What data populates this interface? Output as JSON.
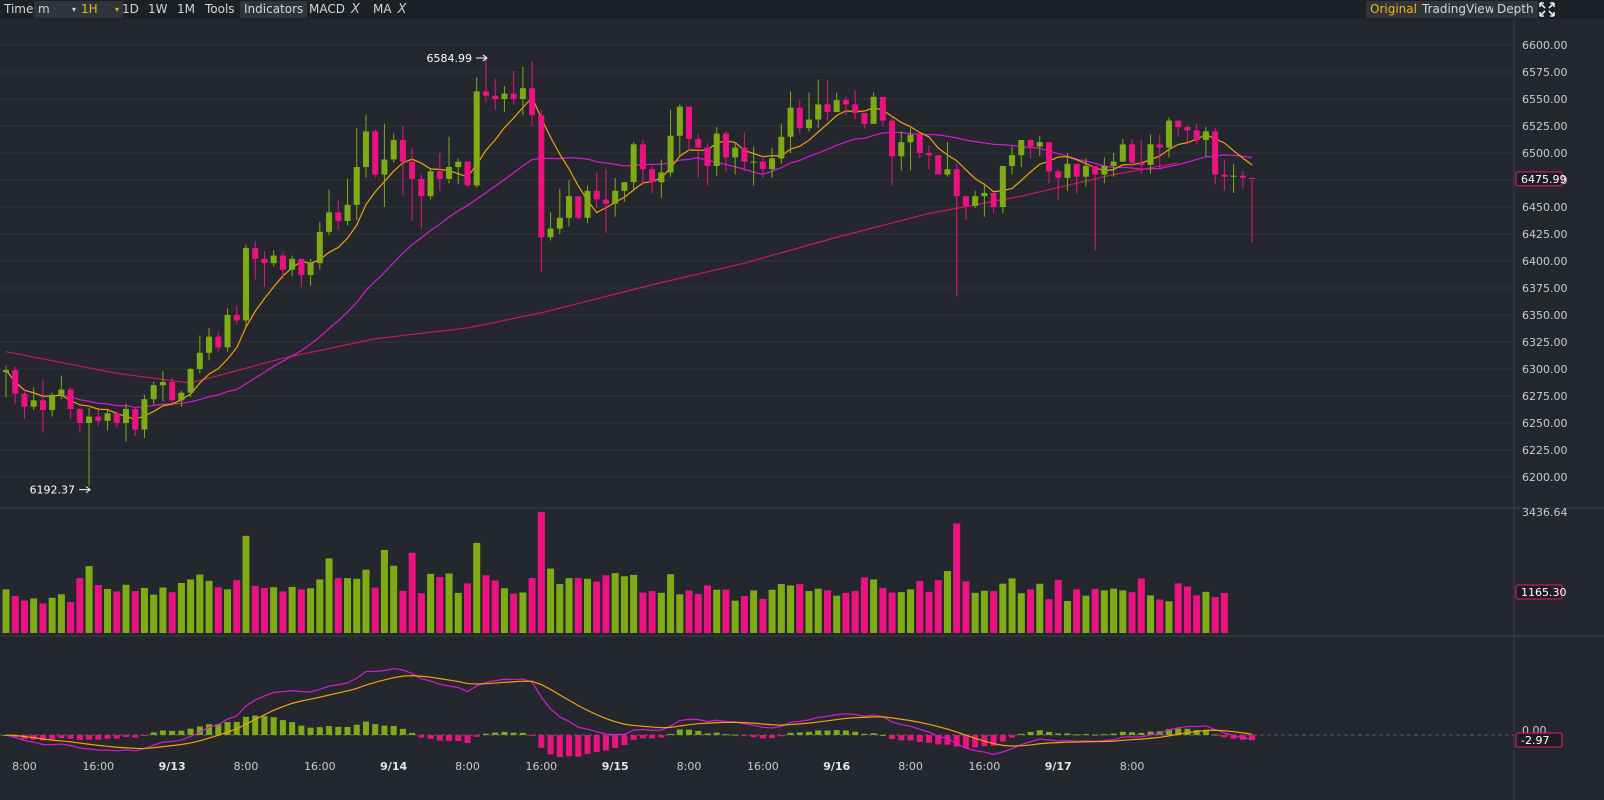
{
  "toolbar": {
    "time": "Time",
    "minute": "m",
    "hour": "1H",
    "day": "1D",
    "week": "1W",
    "month": "1M",
    "tools": "Tools",
    "indicators": "Indicators",
    "macd": "MACD",
    "ma": "MA",
    "close_mark": "X",
    "original": "Original",
    "tradingview": "TradingView",
    "depth": "Depth",
    "fullscreen_icon": "fullscreen-icon"
  },
  "colors": {
    "up": "#7fac15",
    "down": "#ec1380",
    "ma7": "#f0a30a",
    "ma25": "#d61ad6",
    "ma99": "#c9195e",
    "active": "#f0b90b"
  },
  "chart_data": {
    "type": "candlestick",
    "timeframe": "1H",
    "price_axis": {
      "range": [
        6187.5,
        6612.5
      ],
      "ticks": [
        "6200.00",
        "6225.00",
        "6250.00",
        "6275.00",
        "6300.00",
        "6325.00",
        "6350.00",
        "6375.00",
        "6400.00",
        "6425.00",
        "6450.00",
        "6475.00",
        "6500.00",
        "6525.00",
        "6550.00",
        "6575.00",
        "6600.00"
      ]
    },
    "volume_axis": {
      "max": 3436.64,
      "max_label": "3436.64",
      "current_label": "1165.30",
      "current": 1165.3
    },
    "macd_axis": {
      "zero_label": "0.00",
      "current_label": "-2.97",
      "current": -2.97
    },
    "current_price": 6475.99,
    "current_price_label": "6475.99",
    "high_label": "6584.99",
    "low_label": "6192.37",
    "x_labels": [
      {
        "text": "8:00",
        "date": false,
        "i": 2
      },
      {
        "text": "16:00",
        "date": false,
        "i": 10
      },
      {
        "text": "9/13",
        "date": true,
        "i": 18
      },
      {
        "text": "8:00",
        "date": false,
        "i": 26
      },
      {
        "text": "16:00",
        "date": false,
        "i": 34
      },
      {
        "text": "9/14",
        "date": true,
        "i": 42
      },
      {
        "text": "8:00",
        "date": false,
        "i": 50
      },
      {
        "text": "16:00",
        "date": false,
        "i": 58
      },
      {
        "text": "9/15",
        "date": true,
        "i": 66
      },
      {
        "text": "8:00",
        "date": false,
        "i": 74
      },
      {
        "text": "16:00",
        "date": false,
        "i": 82
      },
      {
        "text": "9/16",
        "date": true,
        "i": 90
      },
      {
        "text": "8:00",
        "date": false,
        "i": 98
      },
      {
        "text": "16:00",
        "date": false,
        "i": 106
      },
      {
        "text": "9/17",
        "date": true,
        "i": 114
      },
      {
        "text": "8:00",
        "date": false,
        "i": 122
      }
    ],
    "ma_windows": [
      7,
      25,
      99
    ],
    "ma99_points": [
      [
        0,
        6316
      ],
      [
        12,
        6296
      ],
      [
        20,
        6287
      ],
      [
        30,
        6310
      ],
      [
        40,
        6328
      ],
      [
        50,
        6338
      ],
      [
        58,
        6352
      ],
      [
        70,
        6378
      ],
      [
        80,
        6398
      ],
      [
        90,
        6422
      ],
      [
        100,
        6444
      ],
      [
        110,
        6460
      ],
      [
        120,
        6480
      ],
      [
        127,
        6491
      ]
    ],
    "candles": [
      [
        6297,
        6299,
        6303,
        6274
      ],
      [
        6299,
        6277,
        6302,
        6268
      ],
      [
        6277,
        6265,
        6282,
        6254
      ],
      [
        6265,
        6271,
        6283,
        6262
      ],
      [
        6271,
        6262,
        6290,
        6241
      ],
      [
        6262,
        6276,
        6278,
        6256
      ],
      [
        6276,
        6281,
        6294,
        6272
      ],
      [
        6281,
        6263,
        6283,
        6254
      ],
      [
        6263,
        6250,
        6264,
        6241
      ],
      [
        6250,
        6256,
        6264,
        6192
      ],
      [
        6256,
        6252,
        6262,
        6247
      ],
      [
        6252,
        6259,
        6262,
        6243
      ],
      [
        6259,
        6250,
        6261,
        6246
      ],
      [
        6250,
        6263,
        6268,
        6233
      ],
      [
        6263,
        6244,
        6265,
        6238
      ],
      [
        6244,
        6272,
        6276,
        6236
      ],
      [
        6272,
        6285,
        6288,
        6267
      ],
      [
        6285,
        6288,
        6298,
        6270
      ],
      [
        6288,
        6271,
        6292,
        6268
      ],
      [
        6271,
        6278,
        6280,
        6265
      ],
      [
        6278,
        6300,
        6301,
        6274
      ],
      [
        6300,
        6315,
        6331,
        6296
      ],
      [
        6315,
        6330,
        6338,
        6308
      ],
      [
        6330,
        6320,
        6334,
        6316
      ],
      [
        6320,
        6350,
        6356,
        6316
      ],
      [
        6350,
        6345,
        6359,
        6341
      ],
      [
        6345,
        6412,
        6415,
        6339
      ],
      [
        6412,
        6402,
        6418,
        6383
      ],
      [
        6402,
        6398,
        6409,
        6376
      ],
      [
        6398,
        6405,
        6410,
        6395
      ],
      [
        6405,
        6392,
        6408,
        6383
      ],
      [
        6392,
        6402,
        6405,
        6386
      ],
      [
        6402,
        6387,
        6398,
        6376
      ],
      [
        6387,
        6398,
        6402,
        6377
      ],
      [
        6398,
        6427,
        6436,
        6392
      ],
      [
        6427,
        6445,
        6466,
        6424
      ],
      [
        6445,
        6437,
        6456,
        6429
      ],
      [
        6437,
        6452,
        6476,
        6433
      ],
      [
        6452,
        6487,
        6523,
        6438
      ],
      [
        6487,
        6520,
        6535,
        6477
      ],
      [
        6520,
        6480,
        6522,
        6477
      ],
      [
        6480,
        6494,
        6527,
        6450
      ],
      [
        6494,
        6512,
        6518,
        6491
      ],
      [
        6512,
        6492,
        6525,
        6461
      ],
      [
        6492,
        6476,
        6505,
        6437
      ],
      [
        6476,
        6460,
        6480,
        6430
      ],
      [
        6460,
        6483,
        6486,
        6457
      ],
      [
        6483,
        6476,
        6500,
        6465
      ],
      [
        6476,
        6487,
        6515,
        6472
      ],
      [
        6487,
        6492,
        6495,
        6471
      ],
      [
        6492,
        6470,
        6491,
        6468
      ],
      [
        6470,
        6557,
        6570,
        6468
      ],
      [
        6557,
        6553,
        6588,
        6547
      ],
      [
        6553,
        6550,
        6569,
        6540
      ],
      [
        6550,
        6555,
        6562,
        6538
      ],
      [
        6555,
        6550,
        6576,
        6545
      ],
      [
        6550,
        6560,
        6580,
        6535
      ],
      [
        6560,
        6535,
        6585,
        6525
      ],
      [
        6535,
        6422,
        6540,
        6390
      ],
      [
        6422,
        6430,
        6445,
        6419
      ],
      [
        6430,
        6440,
        6467,
        6425
      ],
      [
        6440,
        6460,
        6475,
        6432
      ],
      [
        6460,
        6440,
        6458,
        6438
      ],
      [
        6440,
        6465,
        6470,
        6435
      ],
      [
        6465,
        6457,
        6482,
        6449
      ],
      [
        6457,
        6453,
        6485,
        6426
      ],
      [
        6453,
        6465,
        6477,
        6441
      ],
      [
        6465,
        6473,
        6473,
        6455
      ],
      [
        6473,
        6508,
        6510,
        6465
      ],
      [
        6508,
        6485,
        6512,
        6470
      ],
      [
        6485,
        6473,
        6488,
        6463
      ],
      [
        6473,
        6482,
        6494,
        6458
      ],
      [
        6482,
        6516,
        6540,
        6478
      ],
      [
        6516,
        6543,
        6545,
        6497
      ],
      [
        6543,
        6513,
        6540,
        6502
      ],
      [
        6513,
        6505,
        6518,
        6477
      ],
      [
        6505,
        6488,
        6509,
        6470
      ],
      [
        6488,
        6518,
        6524,
        6479
      ],
      [
        6518,
        6496,
        6520,
        6483
      ],
      [
        6496,
        6505,
        6510,
        6480
      ],
      [
        6505,
        6492,
        6519,
        6483
      ],
      [
        6492,
        6492,
        6506,
        6470
      ],
      [
        6492,
        6485,
        6498,
        6477
      ],
      [
        6485,
        6495,
        6505,
        6477
      ],
      [
        6495,
        6515,
        6527,
        6490
      ],
      [
        6515,
        6542,
        6557,
        6500
      ],
      [
        6542,
        6523,
        6549,
        6518
      ],
      [
        6523,
        6531,
        6556,
        6520
      ],
      [
        6531,
        6545,
        6568,
        6523
      ],
      [
        6545,
        6538,
        6567,
        6530
      ],
      [
        6538,
        6549,
        6556,
        6540
      ],
      [
        6549,
        6545,
        6552,
        6535
      ],
      [
        6545,
        6537,
        6558,
        6531
      ],
      [
        6537,
        6527,
        6534,
        6523
      ],
      [
        6527,
        6552,
        6556,
        6528
      ],
      [
        6552,
        6530,
        6542,
        6525
      ],
      [
        6530,
        6497,
        6532,
        6470
      ],
      [
        6497,
        6510,
        6520,
        6484
      ],
      [
        6510,
        6517,
        6523,
        6484
      ],
      [
        6517,
        6500,
        6518,
        6495
      ],
      [
        6500,
        6498,
        6507,
        6485
      ],
      [
        6498,
        6480,
        6493,
        6482
      ],
      [
        6480,
        6485,
        6510,
        6478
      ],
      [
        6485,
        6460,
        6490,
        6367
      ],
      [
        6460,
        6451,
        6458,
        6438
      ],
      [
        6451,
        6460,
        6465,
        6449
      ],
      [
        6460,
        6463,
        6472,
        6441
      ],
      [
        6463,
        6450,
        6453,
        6444
      ],
      [
        6450,
        6488,
        6488,
        6444
      ],
      [
        6488,
        6498,
        6506,
        6480
      ],
      [
        6498,
        6512,
        6512,
        6487
      ],
      [
        6512,
        6506,
        6513,
        6495
      ],
      [
        6506,
        6510,
        6516,
        6497
      ],
      [
        6510,
        6483,
        6508,
        6472
      ],
      [
        6483,
        6477,
        6485,
        6457
      ],
      [
        6477,
        6490,
        6500,
        6465
      ],
      [
        6490,
        6478,
        6485,
        6462
      ],
      [
        6478,
        6488,
        6495,
        6469
      ],
      [
        6488,
        6480,
        6485,
        6410
      ],
      [
        6480,
        6488,
        6496,
        6472
      ],
      [
        6488,
        6492,
        6500,
        6478
      ],
      [
        6492,
        6508,
        6513,
        6493
      ],
      [
        6508,
        6491,
        6513,
        6488
      ],
      [
        6491,
        6489,
        6512,
        6481
      ],
      [
        6489,
        6508,
        6517,
        6481
      ],
      [
        6508,
        6505,
        6518,
        6485
      ],
      [
        6505,
        6530,
        6533,
        6496
      ],
      [
        6530,
        6524,
        6528,
        6516
      ],
      [
        6524,
        6521,
        6526,
        6508
      ],
      [
        6521,
        6512,
        6527,
        6508
      ],
      [
        6512,
        6520,
        6524,
        6497
      ],
      [
        6520,
        6480,
        6523,
        6471
      ],
      [
        6480,
        6478,
        6494,
        6465
      ],
      [
        6478,
        6479,
        6490,
        6463
      ],
      [
        6479,
        6477,
        6483,
        6467
      ],
      [
        6477,
        6476,
        6475,
        6417
      ]
    ],
    "volumes": [
      1240,
      1050,
      920,
      980,
      840,
      1000,
      1100,
      880,
      1560,
      1900,
      1360,
      1250,
      1180,
      1370,
      1190,
      1280,
      1090,
      1290,
      1160,
      1420,
      1520,
      1660,
      1480,
      1300,
      1240,
      1500,
      2760,
      1340,
      1280,
      1300,
      1180,
      1310,
      1240,
      1270,
      1520,
      2120,
      1560,
      1560,
      1540,
      1800,
      1290,
      2360,
      1910,
      1200,
      2280,
      1130,
      1680,
      1590,
      1690,
      1140,
      1410,
      2560,
      1640,
      1490,
      1270,
      1120,
      1150,
      1560,
      3440,
      1830,
      1390,
      1560,
      1560,
      1540,
      1460,
      1640,
      1700,
      1610,
      1650,
      1150,
      1190,
      1140,
      1670,
      1100,
      1210,
      1110,
      1350,
      1230,
      1230,
      920,
      1050,
      1210,
      970,
      1230,
      1390,
      1350,
      1390,
      1190,
      1260,
      1210,
      1060,
      1140,
      1190,
      1580,
      1520,
      1280,
      1150,
      1160,
      1240,
      1480,
      1170,
      1500,
      1760,
      3110,
      1470,
      1140,
      1200,
      1190,
      1400,
      1550,
      1130,
      1240,
      1400,
      960,
      1510,
      910,
      1240,
      1060,
      1250,
      1210,
      1260,
      1210,
      1160,
      1550,
      1070,
      950,
      900,
      1410,
      1320,
      1070,
      1170,
      1020,
      1140
    ]
  }
}
